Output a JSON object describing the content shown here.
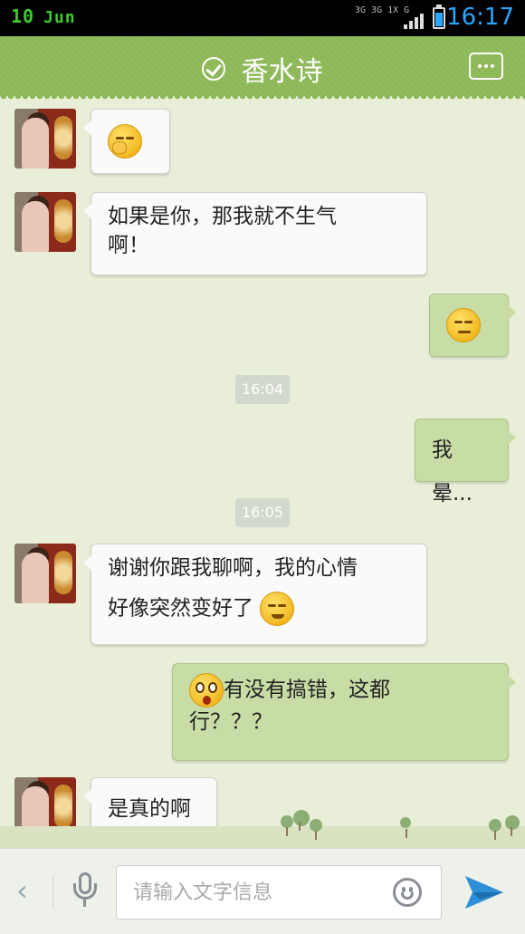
{
  "statusbar": {
    "date_day": "10",
    "date_month": "Jun",
    "network": "3G 3G 1X G",
    "time": "16:17",
    "battery_level": 0.75,
    "accent_color": "#2aa6ff"
  },
  "header": {
    "title": "香水诗",
    "verified_icon": "check-circle-icon",
    "menu_icon": "more-dots-icon",
    "bg_color": "#8db857"
  },
  "messages": [
    {
      "side": "in",
      "emoji": "hug-emoji",
      "text": ""
    },
    {
      "side": "in",
      "text_line1": "如果是你，那我就不生气",
      "text_line2": "啊！"
    },
    {
      "side": "out",
      "emoji": "meh-emoji",
      "text": ""
    },
    {
      "type": "time",
      "text": "16:04"
    },
    {
      "side": "out",
      "text": "我晕..."
    },
    {
      "type": "time",
      "text": "16:05"
    },
    {
      "side": "in",
      "text_line1": "谢谢你跟我聊啊，我的心情",
      "text_line2": "好像突然变好了",
      "emoji": "smile-emoji"
    },
    {
      "side": "out",
      "emoji": "shock-emoji",
      "text_line1": "有没有搞错，这都",
      "text_line2": "行？？？"
    },
    {
      "side": "in",
      "text": "是真的啊"
    }
  ],
  "inputbar": {
    "placeholder": "请输入文字信息",
    "back_icon": "chevron-left-icon",
    "voice_icon": "microphone-icon",
    "emoji_icon": "smiley-icon",
    "send_icon": "send-plane-icon",
    "send_color": "#2d8fd6"
  }
}
